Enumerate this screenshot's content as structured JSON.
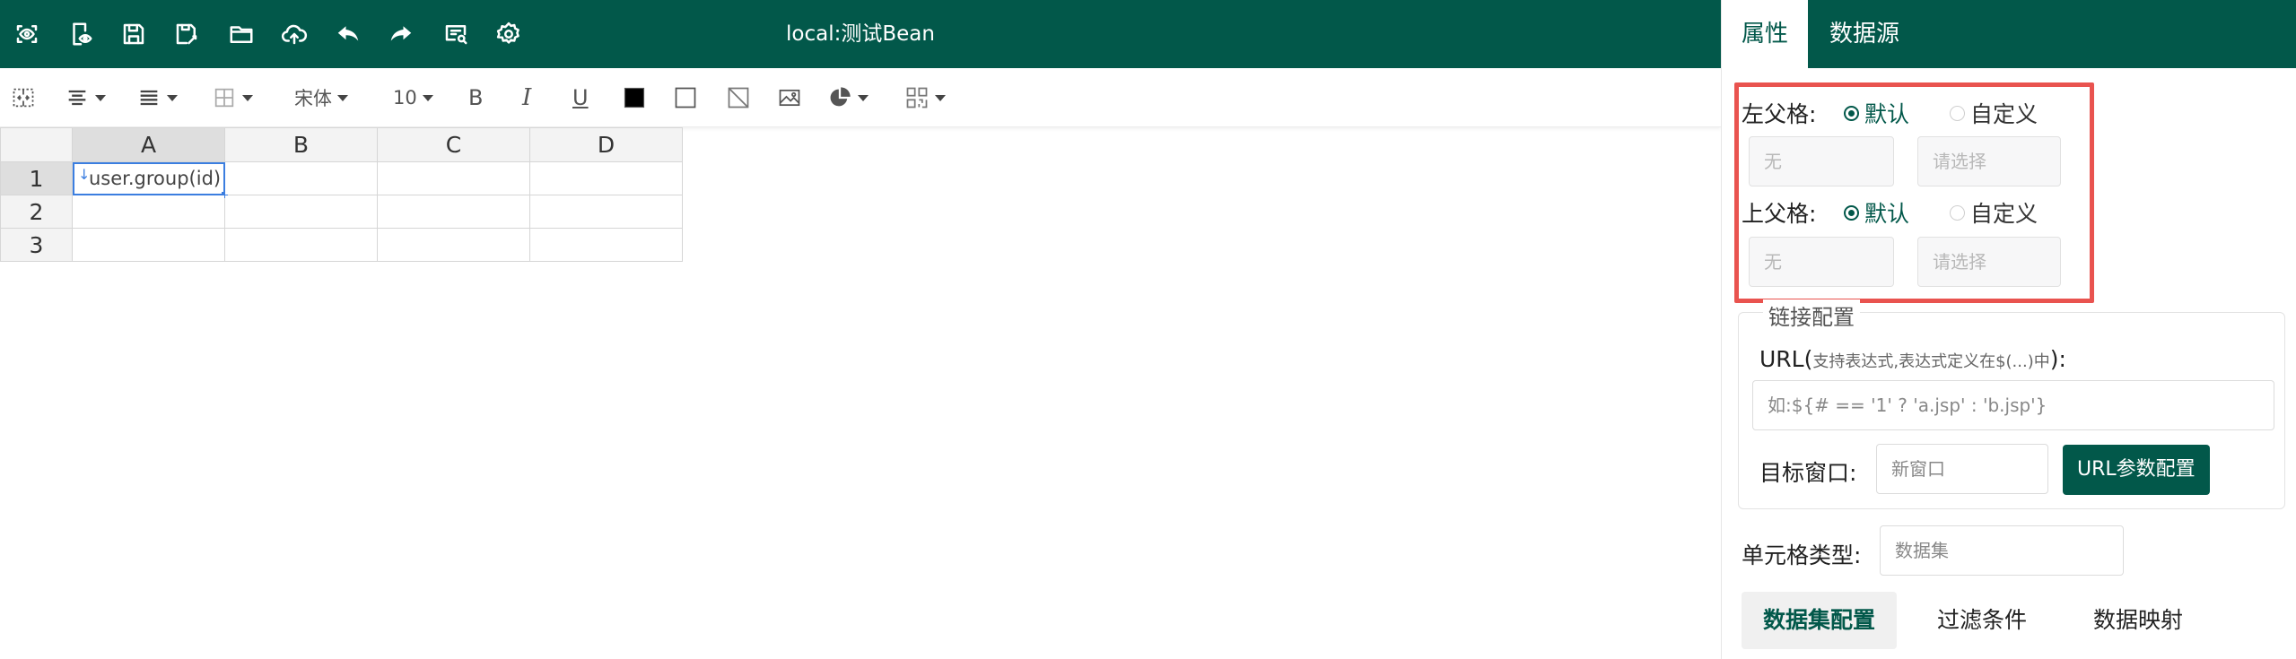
{
  "title": "local:测试Bean",
  "topbar_icons": [
    "preview-icon",
    "mobile-preview-icon",
    "save-icon",
    "save-as-icon",
    "open-folder-icon",
    "upload-icon",
    "undo-icon",
    "redo-icon",
    "print-preview-icon",
    "settings-icon"
  ],
  "toolbar": {
    "font_name": "宋体",
    "font_size": "10",
    "bold_glyph": "B",
    "italic_glyph": "I",
    "underline_glyph": "U"
  },
  "grid": {
    "columns": [
      "A",
      "B",
      "C",
      "D"
    ],
    "rows": [
      "1",
      "2",
      "3"
    ],
    "cells": {
      "A1": "user.group(id)"
    },
    "down_arrow": "↓"
  },
  "panel": {
    "tabs": [
      "属性",
      "数据源"
    ],
    "left_parent": {
      "label": "左父格:",
      "options": [
        "默认",
        "自定义"
      ],
      "selected": "默认",
      "value_placeholder": "无",
      "select_placeholder": "请选择"
    },
    "top_parent": {
      "label": "上父格:",
      "options": [
        "默认",
        "自定义"
      ],
      "selected": "默认",
      "value_placeholder": "无",
      "select_placeholder": "请选择"
    },
    "link_config": {
      "legend": "链接配置",
      "url_label": "URL(",
      "url_hint": "支持表达式,表达式定义在$(...)中",
      "url_label_end": "):",
      "url_placeholder": "如:${# == '1' ? 'a.jsp' : 'b.jsp'}",
      "target_label": "目标窗口:",
      "target_placeholder": "新窗口",
      "param_button": "URL参数配置"
    },
    "cell_type": {
      "label": "单元格类型:",
      "value": "数据集"
    },
    "subtabs": [
      "数据集配置",
      "过滤条件",
      "数据映射"
    ],
    "colors": {
      "brand": "#02584a",
      "highlight": "#e9534f"
    }
  }
}
